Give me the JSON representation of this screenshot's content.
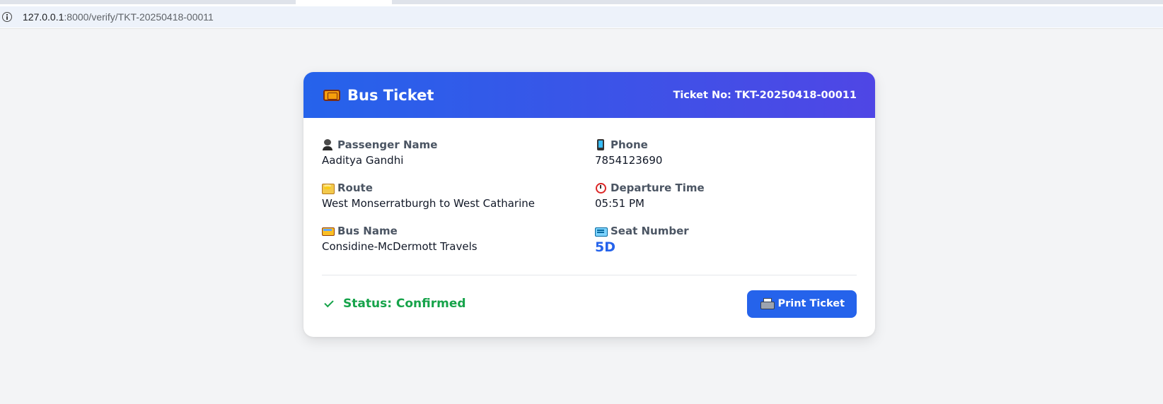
{
  "browser": {
    "url_host": "127.0.0.1",
    "url_path": ":8000/verify/TKT-20250418-00011"
  },
  "ticket": {
    "title": "Bus Ticket",
    "ticket_no": "Ticket No: TKT-20250418-00011",
    "fields": {
      "passenger_label": "Passenger Name",
      "passenger_value": "Aaditya Gandhi",
      "phone_label": "Phone",
      "phone_value": "7854123690",
      "route_label": "Route",
      "route_value": "West Monserratburgh to West Catharine",
      "departure_label": "Departure Time",
      "departure_value": "05:51 PM",
      "bus_label": "Bus Name",
      "bus_value": "Considine-McDermott Travels",
      "seat_label": "Seat Number",
      "seat_value": "5D"
    },
    "status": "Status: Confirmed",
    "print_label": "Print Ticket"
  },
  "colors": {
    "header_start": "#2563eb",
    "header_end": "#4f46e5",
    "status_green": "#16a34a",
    "button_blue": "#2563eb",
    "seat_blue": "#2563eb"
  },
  "icons": {
    "header": "ticket-icon",
    "passenger": "person-icon",
    "phone": "mobile-phone-icon",
    "route": "sunrise-map-icon",
    "departure": "alarm-clock-icon",
    "bus": "bus-icon",
    "seat": "ticket-seat-icon",
    "status": "check-icon",
    "print": "printer-icon"
  }
}
